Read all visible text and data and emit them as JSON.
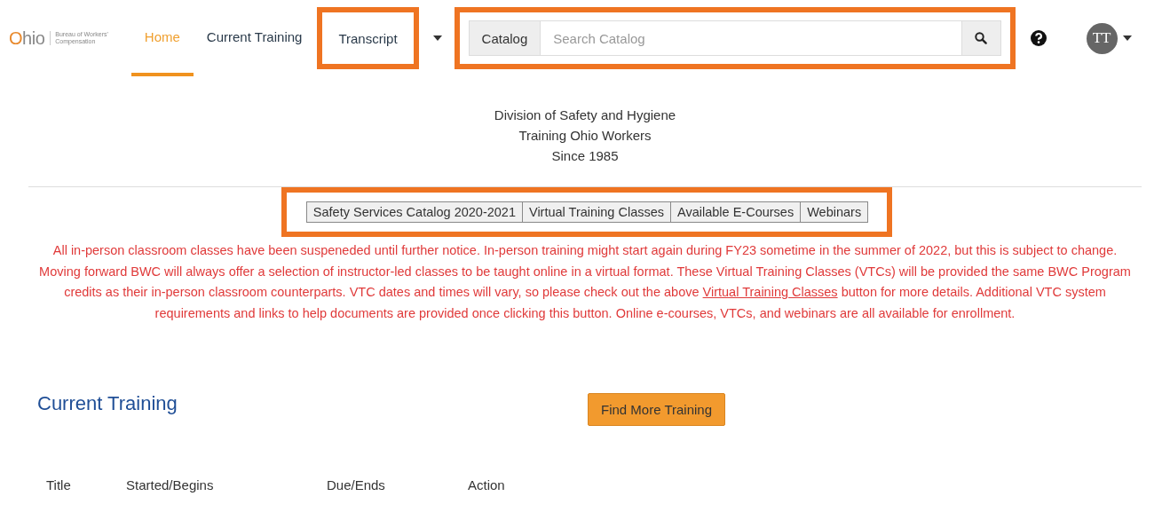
{
  "header": {
    "logo": {
      "wordmark": "Ohio",
      "agency_line_1": "Bureau of Workers'",
      "agency_line_2": "Compensation"
    },
    "nav": [
      {
        "label": "Home",
        "selected": true,
        "highlighted": false
      },
      {
        "label": "Current Training",
        "selected": false,
        "highlighted": false
      },
      {
        "label": "Transcript",
        "selected": false,
        "highlighted": true
      }
    ],
    "search": {
      "scope": "Catalog",
      "placeholder": "Search Catalog",
      "highlighted": true
    },
    "avatar": {
      "initials": "TT"
    }
  },
  "intro": [
    "Division of Safety and Hygiene",
    "Training Ohio Workers",
    "Since 1985"
  ],
  "quick_links": {
    "highlighted": true,
    "buttons": [
      "Safety Services Catalog 2020-2021",
      "Virtual Training Classes",
      "Available E-Courses",
      "Webinars"
    ]
  },
  "notice": {
    "before": "All in-person classroom classes have been suspeneded until further notice. In-person training might start again during FY23 sometime in the summer of 2022, but this is subject to change. Moving forward BWC will always offer a selection of instructor-led classes to be taught online in a virtual format. These Virtual Training Classes (VTCs) will be provided the same BWC Program credits as their in-person classroom counterparts. VTC dates and times will vary, so please check out the above",
    "link": "Virtual Training Classes",
    "after": "button for more details. Additional VTC system requirements and links to help documents are provided once clicking this button. Online e-courses, VTCs, and webinars are all available for enrollment."
  },
  "current_training": {
    "title": "Current Training",
    "button": "Find More Training",
    "columns": [
      "Title",
      "Started/Begins",
      "Due/Ends",
      "Action"
    ]
  }
}
